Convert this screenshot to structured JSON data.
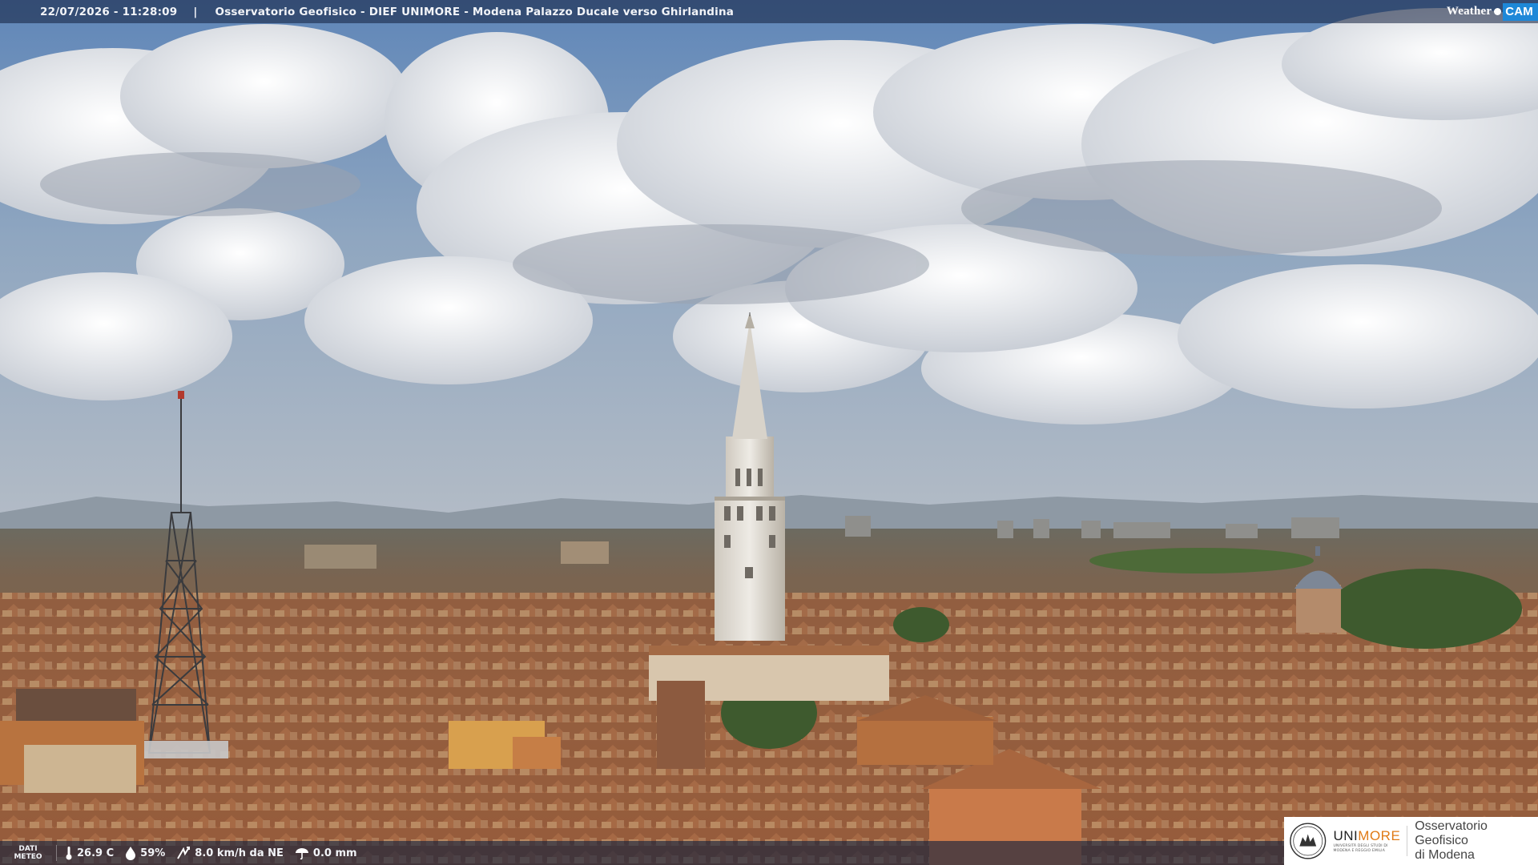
{
  "header": {
    "timestamp": "22/07/2026 - 11:28:09",
    "separator": "|",
    "title": "Osservatorio Geofisico - DIEF UNIMORE - Modena Palazzo Ducale verso Ghirlandina",
    "brand_weather": "Weather",
    "brand_cam": "CAM"
  },
  "weather": {
    "dati_line1": "DATI",
    "dati_line2": "METEO",
    "temperature": "26.9 C",
    "humidity": "59%",
    "wind": "8.0 km/h da NE",
    "rain": "0.0 mm"
  },
  "logo": {
    "uni_a": "UNI",
    "uni_b": "MORE",
    "uni_sub1": "UNIVERSITÀ DEGLI STUDI DI",
    "uni_sub2": "MODENA E REGGIO EMILIA",
    "obs_line1": "Osservatorio Geofisico",
    "obs_line2": "di Modena"
  },
  "colors": {
    "bar_bg": "#101e3c",
    "accent_cam": "#1e88d8",
    "accent_more": "#e07a16",
    "sky": "#7f9bbd",
    "roofs": "#a0643e"
  },
  "icons": [
    "thermometer-icon",
    "humidity-drop-icon",
    "wind-icon",
    "rain-icon",
    "unimore-seal-icon"
  ]
}
